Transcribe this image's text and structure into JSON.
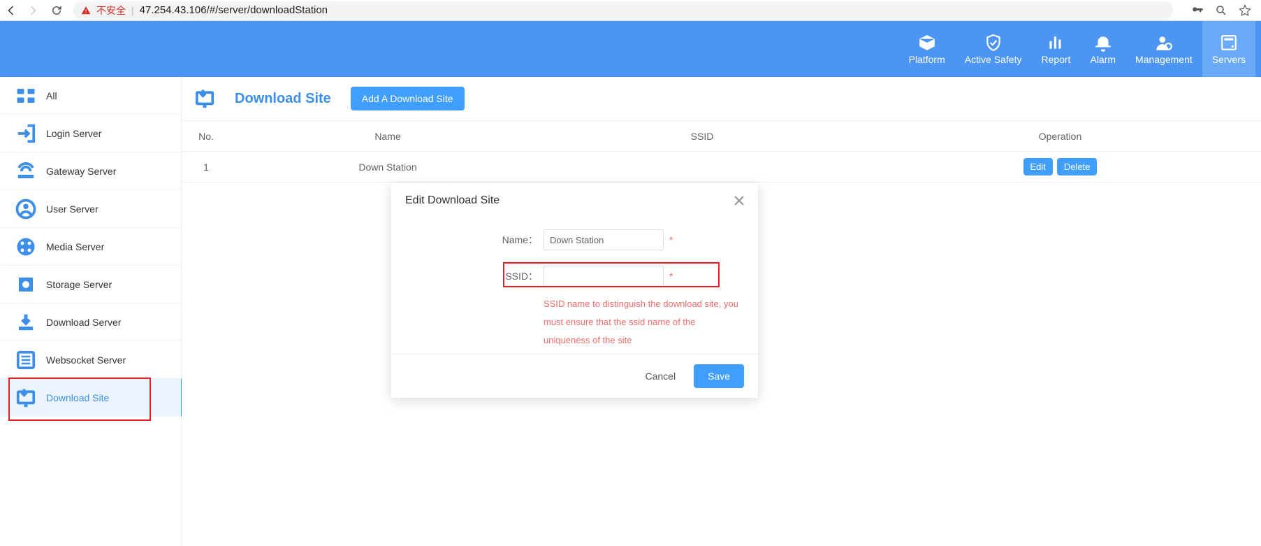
{
  "browser": {
    "insecure_label": "不安全",
    "url": "47.254.43.106/#/server/downloadStation"
  },
  "topnav": {
    "items": [
      {
        "label": "Platform",
        "icon": "platform"
      },
      {
        "label": "Active Safety",
        "icon": "safety"
      },
      {
        "label": "Report",
        "icon": "report"
      },
      {
        "label": "Alarm",
        "icon": "alarm"
      },
      {
        "label": "Management",
        "icon": "management"
      },
      {
        "label": "Servers",
        "icon": "servers"
      }
    ]
  },
  "sidebar": {
    "items": [
      {
        "label": "All"
      },
      {
        "label": "Login Server"
      },
      {
        "label": "Gateway Server"
      },
      {
        "label": "User Server"
      },
      {
        "label": "Media Server"
      },
      {
        "label": "Storage Server"
      },
      {
        "label": "Download Server"
      },
      {
        "label": "Websocket Server"
      },
      {
        "label": "Download Site"
      }
    ]
  },
  "page": {
    "title": "Download Site",
    "add_button": "Add A Download Site"
  },
  "table": {
    "headers": {
      "no": "No.",
      "name": "Name",
      "ssid": "SSID",
      "operation": "Operation"
    },
    "rows": [
      {
        "no": "1",
        "name": "Down Station",
        "ssid": "",
        "edit": "Edit",
        "delete": "Delete"
      }
    ]
  },
  "dialog": {
    "title": "Edit Download Site",
    "name_label": "Name：",
    "name_value": "Down Station",
    "ssid_label": "SSID：",
    "ssid_value": "",
    "required_mark": "*",
    "hint": "SSID name to distinguish the download site, you must ensure that the ssid name of the uniqueness of the site",
    "cancel": "Cancel",
    "save": "Save"
  }
}
